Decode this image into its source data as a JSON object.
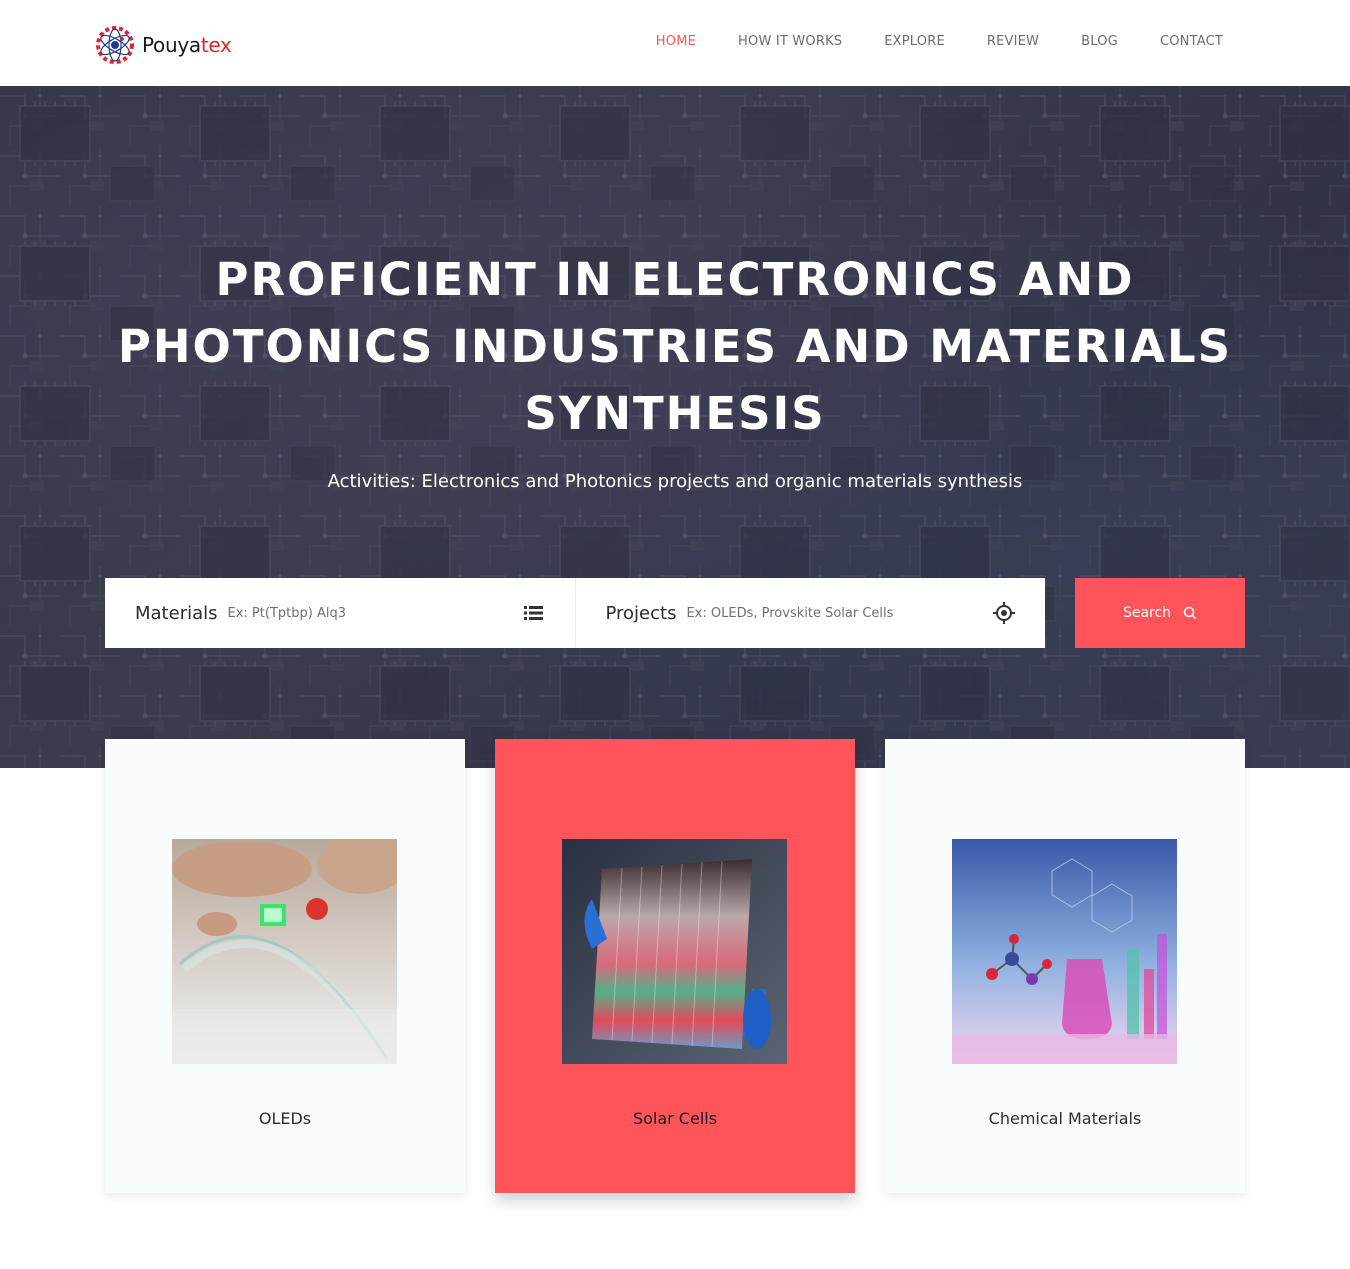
{
  "brand": {
    "name_main": "Pouya",
    "name_accent": "tex",
    "accent_color": "#e3262b"
  },
  "nav": {
    "items": [
      {
        "label": "HOME",
        "active": true
      },
      {
        "label": "HOW IT WORKS",
        "active": false
      },
      {
        "label": "EXPLORE",
        "active": false
      },
      {
        "label": "REVIEW",
        "active": false
      },
      {
        "label": "BLOG",
        "active": false
      },
      {
        "label": "CONTACT",
        "active": false
      }
    ],
    "active_color": "#ff545a"
  },
  "hero": {
    "title": "PROFICIENT IN ELECTRONICS AND PHOTONICS INDUSTRIES AND MATERIALS SYNTHESIS",
    "subtitle": "Activities: Electronics and Photonics projects and organic materials synthesis"
  },
  "search": {
    "materials_label": "Materials",
    "materials_placeholder": "Ex: Pt(Tptbp) Alq3",
    "materials_icon": "list-icon",
    "projects_label": "Projects",
    "projects_placeholder": "Ex: OLEDs, Provskite Solar Cells",
    "projects_icon": "crosshair-icon",
    "button_label": "Search",
    "button_icon": "search-icon",
    "button_color": "#ff545a"
  },
  "categories": [
    {
      "label": "OLEDs",
      "image": "flexible-oled-image",
      "featured": false
    },
    {
      "label": "Solar Cells",
      "image": "solar-cell-image",
      "featured": true
    },
    {
      "label": "Chemical Materials",
      "image": "chemistry-lab-image",
      "featured": false
    }
  ]
}
